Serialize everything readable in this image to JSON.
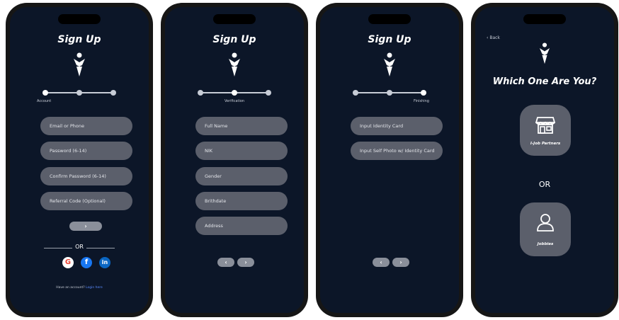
{
  "screens": {
    "account": {
      "title": "Sign Up",
      "step_label": "Account",
      "fields": [
        "Email or Phone",
        "Password (6-14)",
        "Confirm Password (6-14)",
        "Referral Code (Optional)"
      ],
      "or_label": "OR",
      "social": {
        "google_icon": "google-icon",
        "facebook_icon": "facebook-icon",
        "linkedin_icon": "linkedin-icon"
      },
      "have_account": "Have an account?",
      "login_link": "Login here"
    },
    "verification": {
      "title": "Sign Up",
      "step_label": "Verification",
      "fields": [
        "Full Name",
        "NIK",
        "Gender",
        "Brithdate",
        "Address"
      ]
    },
    "finishing": {
      "title": "Sign Up",
      "step_label": "Finishing",
      "fields": [
        "Input Identity Card",
        "Input Self Photo w/ Identity Card"
      ]
    },
    "role": {
      "back_label": "Back",
      "heading": "Which One Are You?",
      "option_partner": "I-Job Partners",
      "or_label": "OR",
      "option_jobbies": "Jobbies"
    }
  },
  "colors": {
    "background": "#0c1628",
    "field": "#5b5f6b",
    "accent_link": "#5b8cff"
  }
}
